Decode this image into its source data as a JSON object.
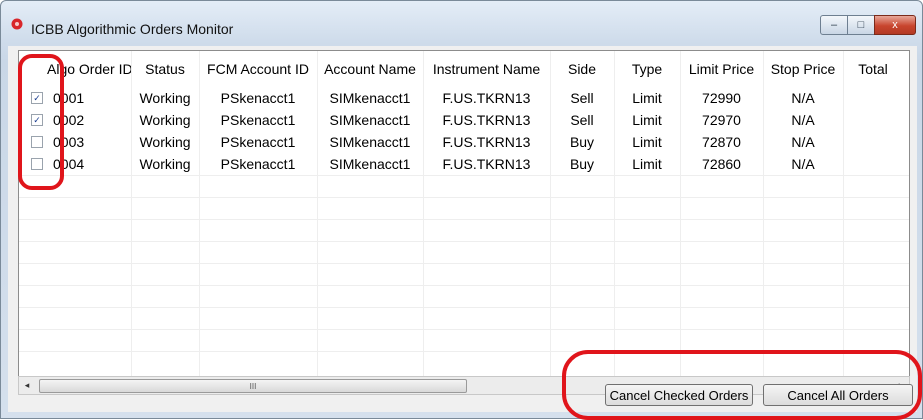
{
  "window": {
    "title": "ICBB Algorithmic Orders Monitor",
    "app_icon": "red-gear-icon",
    "controls": {
      "minimize": "–",
      "maximize": "□",
      "close": "x"
    }
  },
  "grid": {
    "columns": [
      "Algo Order ID",
      "Status",
      "FCM Account ID",
      "Account Name",
      "Instrument Name",
      "Side",
      "Type",
      "Limit Price",
      "Stop Price",
      "Total"
    ],
    "rows": [
      {
        "checked": true,
        "id": "0001",
        "status": "Working",
        "fcm": "PSkenacct1",
        "account": "SIMkenacct1",
        "instrument": "F.US.TKRN13",
        "side": "Sell",
        "type": "Limit",
        "limit": "72990",
        "stop": "N/A"
      },
      {
        "checked": true,
        "id": "0002",
        "status": "Working",
        "fcm": "PSkenacct1",
        "account": "SIMkenacct1",
        "instrument": "F.US.TKRN13",
        "side": "Sell",
        "type": "Limit",
        "limit": "72970",
        "stop": "N/A"
      },
      {
        "checked": false,
        "id": "0003",
        "status": "Working",
        "fcm": "PSkenacct1",
        "account": "SIMkenacct1",
        "instrument": "F.US.TKRN13",
        "side": "Buy",
        "type": "Limit",
        "limit": "72870",
        "stop": "N/A"
      },
      {
        "checked": false,
        "id": "0004",
        "status": "Working",
        "fcm": "PSkenacct1",
        "account": "SIMkenacct1",
        "instrument": "F.US.TKRN13",
        "side": "Buy",
        "type": "Limit",
        "limit": "72860",
        "stop": "N/A"
      }
    ],
    "scrollbar": {
      "left_arrow": "◂",
      "right_arrow": "▸",
      "thumb_grip": "III"
    }
  },
  "buttons": {
    "cancel_checked": "Cancel Checked Orders",
    "cancel_all": "Cancel All Orders"
  },
  "colors": {
    "highlight": "#e0151b",
    "check": "#1a3d8f"
  }
}
